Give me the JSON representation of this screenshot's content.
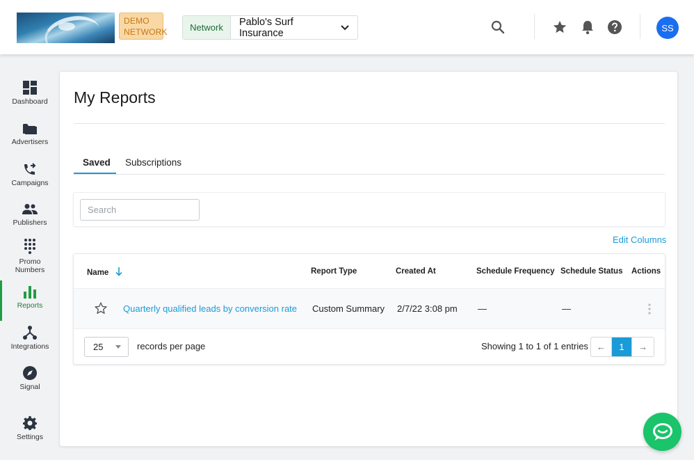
{
  "header": {
    "demo_badge": "DEMO NETWORK",
    "network_label": "Network",
    "network_value": "Pablo's Surf Insurance",
    "avatar_initials": "SS"
  },
  "sidebar": {
    "items": [
      {
        "label": "Dashboard",
        "icon": "dashboard-icon"
      },
      {
        "label": "Advertisers",
        "icon": "folder-icon"
      },
      {
        "label": "Campaigns",
        "icon": "phone-forward-icon"
      },
      {
        "label": "Publishers",
        "icon": "people-icon"
      },
      {
        "label": "Promo Numbers",
        "icon": "dialpad-icon"
      },
      {
        "label": "Reports",
        "icon": "bar-chart-icon",
        "active": true
      },
      {
        "label": "Integrations",
        "icon": "integrations-icon"
      },
      {
        "label": "Signal",
        "icon": "compass-icon"
      },
      {
        "label": "Settings",
        "icon": "gear-icon"
      }
    ]
  },
  "main": {
    "title": "My Reports",
    "tabs": [
      {
        "label": "Saved",
        "active": true
      },
      {
        "label": "Subscriptions",
        "active": false
      }
    ],
    "search": {
      "placeholder": "Search",
      "value": ""
    },
    "edit_columns": "Edit Columns",
    "table": {
      "columns": [
        "Name",
        "Report Type",
        "Created At",
        "Schedule Frequency",
        "Schedule Status",
        "Actions"
      ],
      "rows": [
        {
          "name": "Quarterly qualified leads by conversion rate",
          "report_type": "Custom Summary",
          "created_at": "2/7/22 3:08 pm",
          "schedule_frequency": "—",
          "schedule_status": "—"
        }
      ]
    },
    "pagination": {
      "per_page": "25",
      "per_page_label": "records per page",
      "showing": "Showing 1 to 1 of 1 entries",
      "prev": "←",
      "current": "1",
      "next": "→"
    }
  },
  "colors": {
    "accent": "#1a9bd8",
    "active_nav": "#1e9e43",
    "avatar": "#1a6ef0",
    "chat": "#19c46a"
  }
}
